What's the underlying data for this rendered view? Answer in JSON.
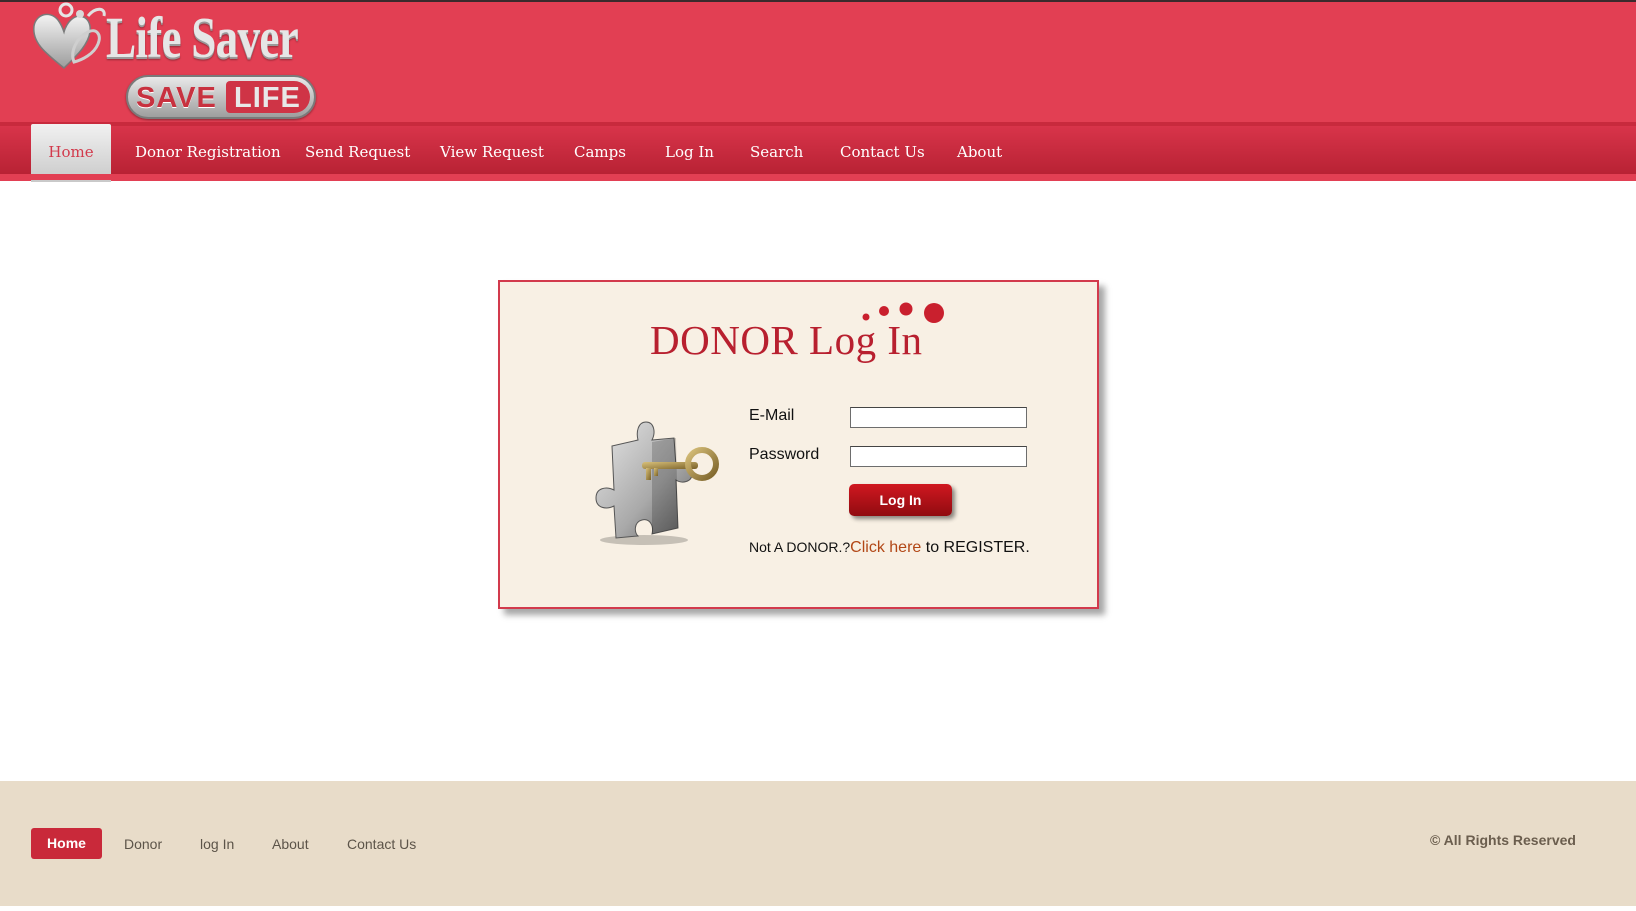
{
  "logo": {
    "title": "Life Saver",
    "badge_left": "SAVE",
    "badge_right": "LIFE"
  },
  "nav": {
    "items": [
      {
        "label": "Home",
        "active": true
      },
      {
        "label": "Donor Registration"
      },
      {
        "label": "Send Request"
      },
      {
        "label": "View Request"
      },
      {
        "label": "Camps"
      },
      {
        "label": "Log In"
      },
      {
        "label": "Search"
      },
      {
        "label": "Contact Us"
      },
      {
        "label": "About"
      }
    ]
  },
  "login": {
    "title": "DONOR Log In",
    "email_label": "E-Mail",
    "email_value": "",
    "password_label": "Password",
    "password_value": "",
    "submit_label": "Log In",
    "register_prefix": "Not A DONOR.?",
    "register_link": "Click here",
    "register_suffix": " to REGISTER."
  },
  "footer": {
    "items": [
      "Home",
      "Donor",
      "log In",
      "About",
      "Contact Us"
    ],
    "copyright": "© All Rights Reserved"
  },
  "colors": {
    "brand_red": "#e23f53",
    "nav_dark": "#b82234",
    "panel_bg": "#f8f0e4",
    "footer_bg": "#e8dcc9",
    "link": "#b24716"
  }
}
